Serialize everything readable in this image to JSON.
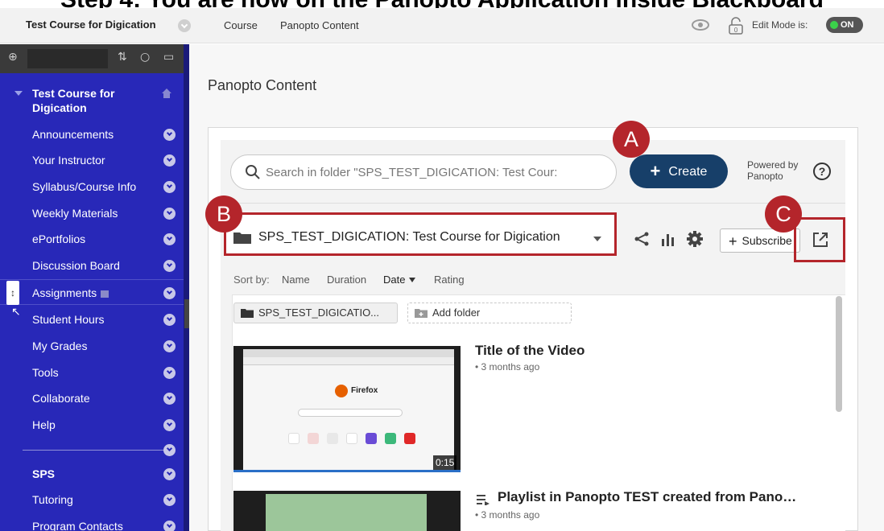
{
  "banner": {
    "text": "Step 4: You are now on the Panopto Application inside Blackboard"
  },
  "topbar": {
    "course_title": "Test Course for Digication",
    "breadcrumbs": [
      "Course",
      "Panopto Content"
    ],
    "edit_mode_label": "Edit Mode is:",
    "edit_mode_value": "ON"
  },
  "sidebar": {
    "header": "Test Course for Digication",
    "items": [
      {
        "label": "Announcements"
      },
      {
        "label": "Your Instructor"
      },
      {
        "label": "Syllabus/Course Info"
      },
      {
        "label": "Weekly Materials"
      },
      {
        "label": "ePortfolios"
      },
      {
        "label": "Discussion Board"
      },
      {
        "label": "Assignments"
      },
      {
        "label": "Student Hours"
      },
      {
        "label": "My Grades"
      },
      {
        "label": "Tools"
      },
      {
        "label": "Collaborate"
      },
      {
        "label": "Help"
      }
    ],
    "section_items": [
      {
        "label": "SPS"
      },
      {
        "label": "Tutoring"
      },
      {
        "label": "Program Contacts"
      }
    ],
    "accent_color": "#2828b8"
  },
  "main": {
    "page_title": "Panopto Content",
    "search_placeholder": "Search in folder \"SPS_TEST_DIGICATION: Test Cour:",
    "create_label": "Create",
    "powered_by": "Powered by Panopto",
    "folder_name": "SPS_TEST_DIGICATION: Test Course for Digication",
    "subscribe_label": "Subscribe",
    "sort_label": "Sort by:",
    "sort_options": [
      "Name",
      "Duration",
      "Date",
      "Rating"
    ],
    "sort_active": "Date",
    "folder_chip": "SPS_TEST_DIGICATIO...",
    "add_folder": "Add folder",
    "videos": [
      {
        "title": "Title of the Video",
        "meta": "• 3 months ago",
        "duration": "0:15",
        "thumb_text": "Firefox"
      },
      {
        "title": "Playlist in Panopto TEST created from Pano…",
        "meta": "• 3 months ago"
      }
    ],
    "brand_color": "#173f69"
  },
  "annotations": {
    "a": "A",
    "b": "B",
    "c": "C",
    "color": "#b4252b"
  }
}
